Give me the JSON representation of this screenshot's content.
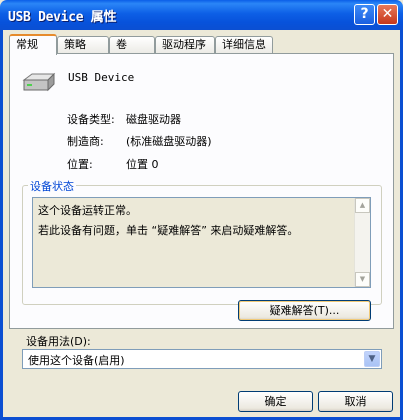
{
  "window": {
    "title": "USB Device 属性",
    "help_label": "?",
    "close_label": "✕"
  },
  "tabs": [
    {
      "label": "常规",
      "active": true
    },
    {
      "label": "策略",
      "active": false
    },
    {
      "label": "卷",
      "active": false
    },
    {
      "label": "驱动程序",
      "active": false
    },
    {
      "label": "详细信息",
      "active": false
    }
  ],
  "device": {
    "name": "USB Device",
    "icon": "disk-drive-icon"
  },
  "properties": [
    {
      "label": "设备类型:",
      "value": "磁盘驱动器"
    },
    {
      "label": "制造商:",
      "value": "(标准磁盘驱动器)"
    },
    {
      "label": "位置:",
      "value": "位置 0"
    }
  ],
  "status": {
    "group_title": "设备状态",
    "line1": "这个设备运转正常。",
    "line2": "若此设备有问题，单击 “疑难解答” 来启动疑难解答。",
    "troubleshoot_label": "疑难解答(T)..."
  },
  "usage": {
    "label": "设备用法(D):",
    "selected": "使用这个设备(启用)"
  },
  "footer": {
    "ok_label": "确定",
    "cancel_label": "取消"
  },
  "colors": {
    "titlebar": "#0b4fd2",
    "dialog_bg": "#ece9d8",
    "group_title": "#0046d5",
    "active_tab_accent": "#e68b2c"
  }
}
